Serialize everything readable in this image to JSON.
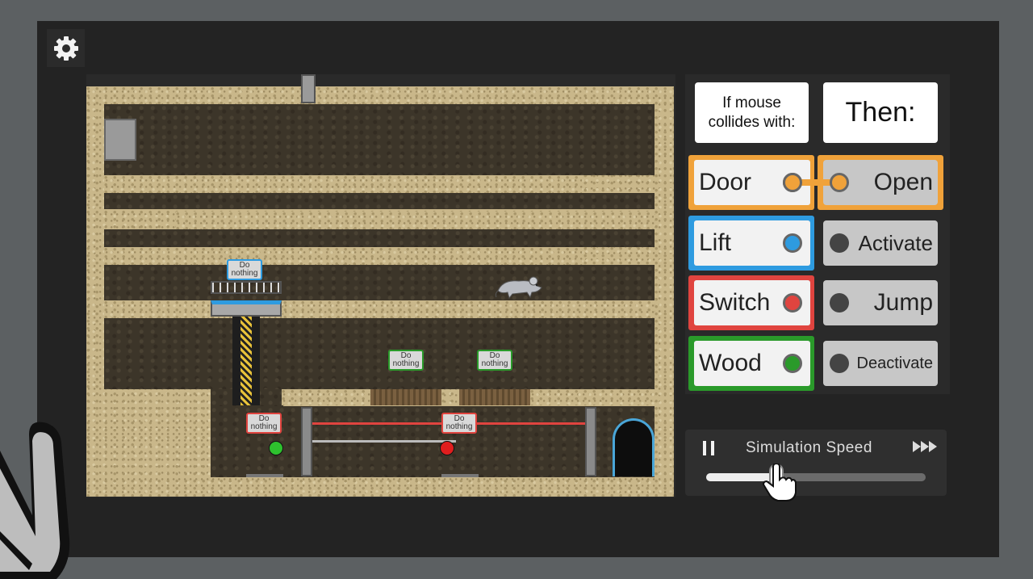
{
  "game": {
    "settings_icon": "gear-icon",
    "tags": [
      {
        "line1": "Do",
        "line2": "nothing"
      },
      {
        "line1": "Do",
        "line2": "nothing"
      },
      {
        "line1": "Do",
        "line2": "nothing"
      },
      {
        "line1": "Do",
        "line2": "nothing"
      },
      {
        "line1": "Do",
        "line2": "nothing"
      }
    ]
  },
  "rules": {
    "header_if": "If mouse collides with:",
    "header_then": "Then:",
    "objects": [
      {
        "label": "Door",
        "color": "#f0a23a"
      },
      {
        "label": "Lift",
        "color": "#2e9be0"
      },
      {
        "label": "Switch",
        "color": "#e0443f"
      },
      {
        "label": "Wood",
        "color": "#2a9a2a"
      }
    ],
    "actions": [
      {
        "label": "Open",
        "connected": true
      },
      {
        "label": "Activate",
        "connected": false
      },
      {
        "label": "Jump",
        "connected": false
      },
      {
        "label": "Deactivate",
        "connected": false
      }
    ]
  },
  "simulation": {
    "label": "Simulation Speed",
    "pause_icon": "pause-icon",
    "fast_forward_icon": "fast-forward-icon",
    "speed_fraction": 0.32
  }
}
